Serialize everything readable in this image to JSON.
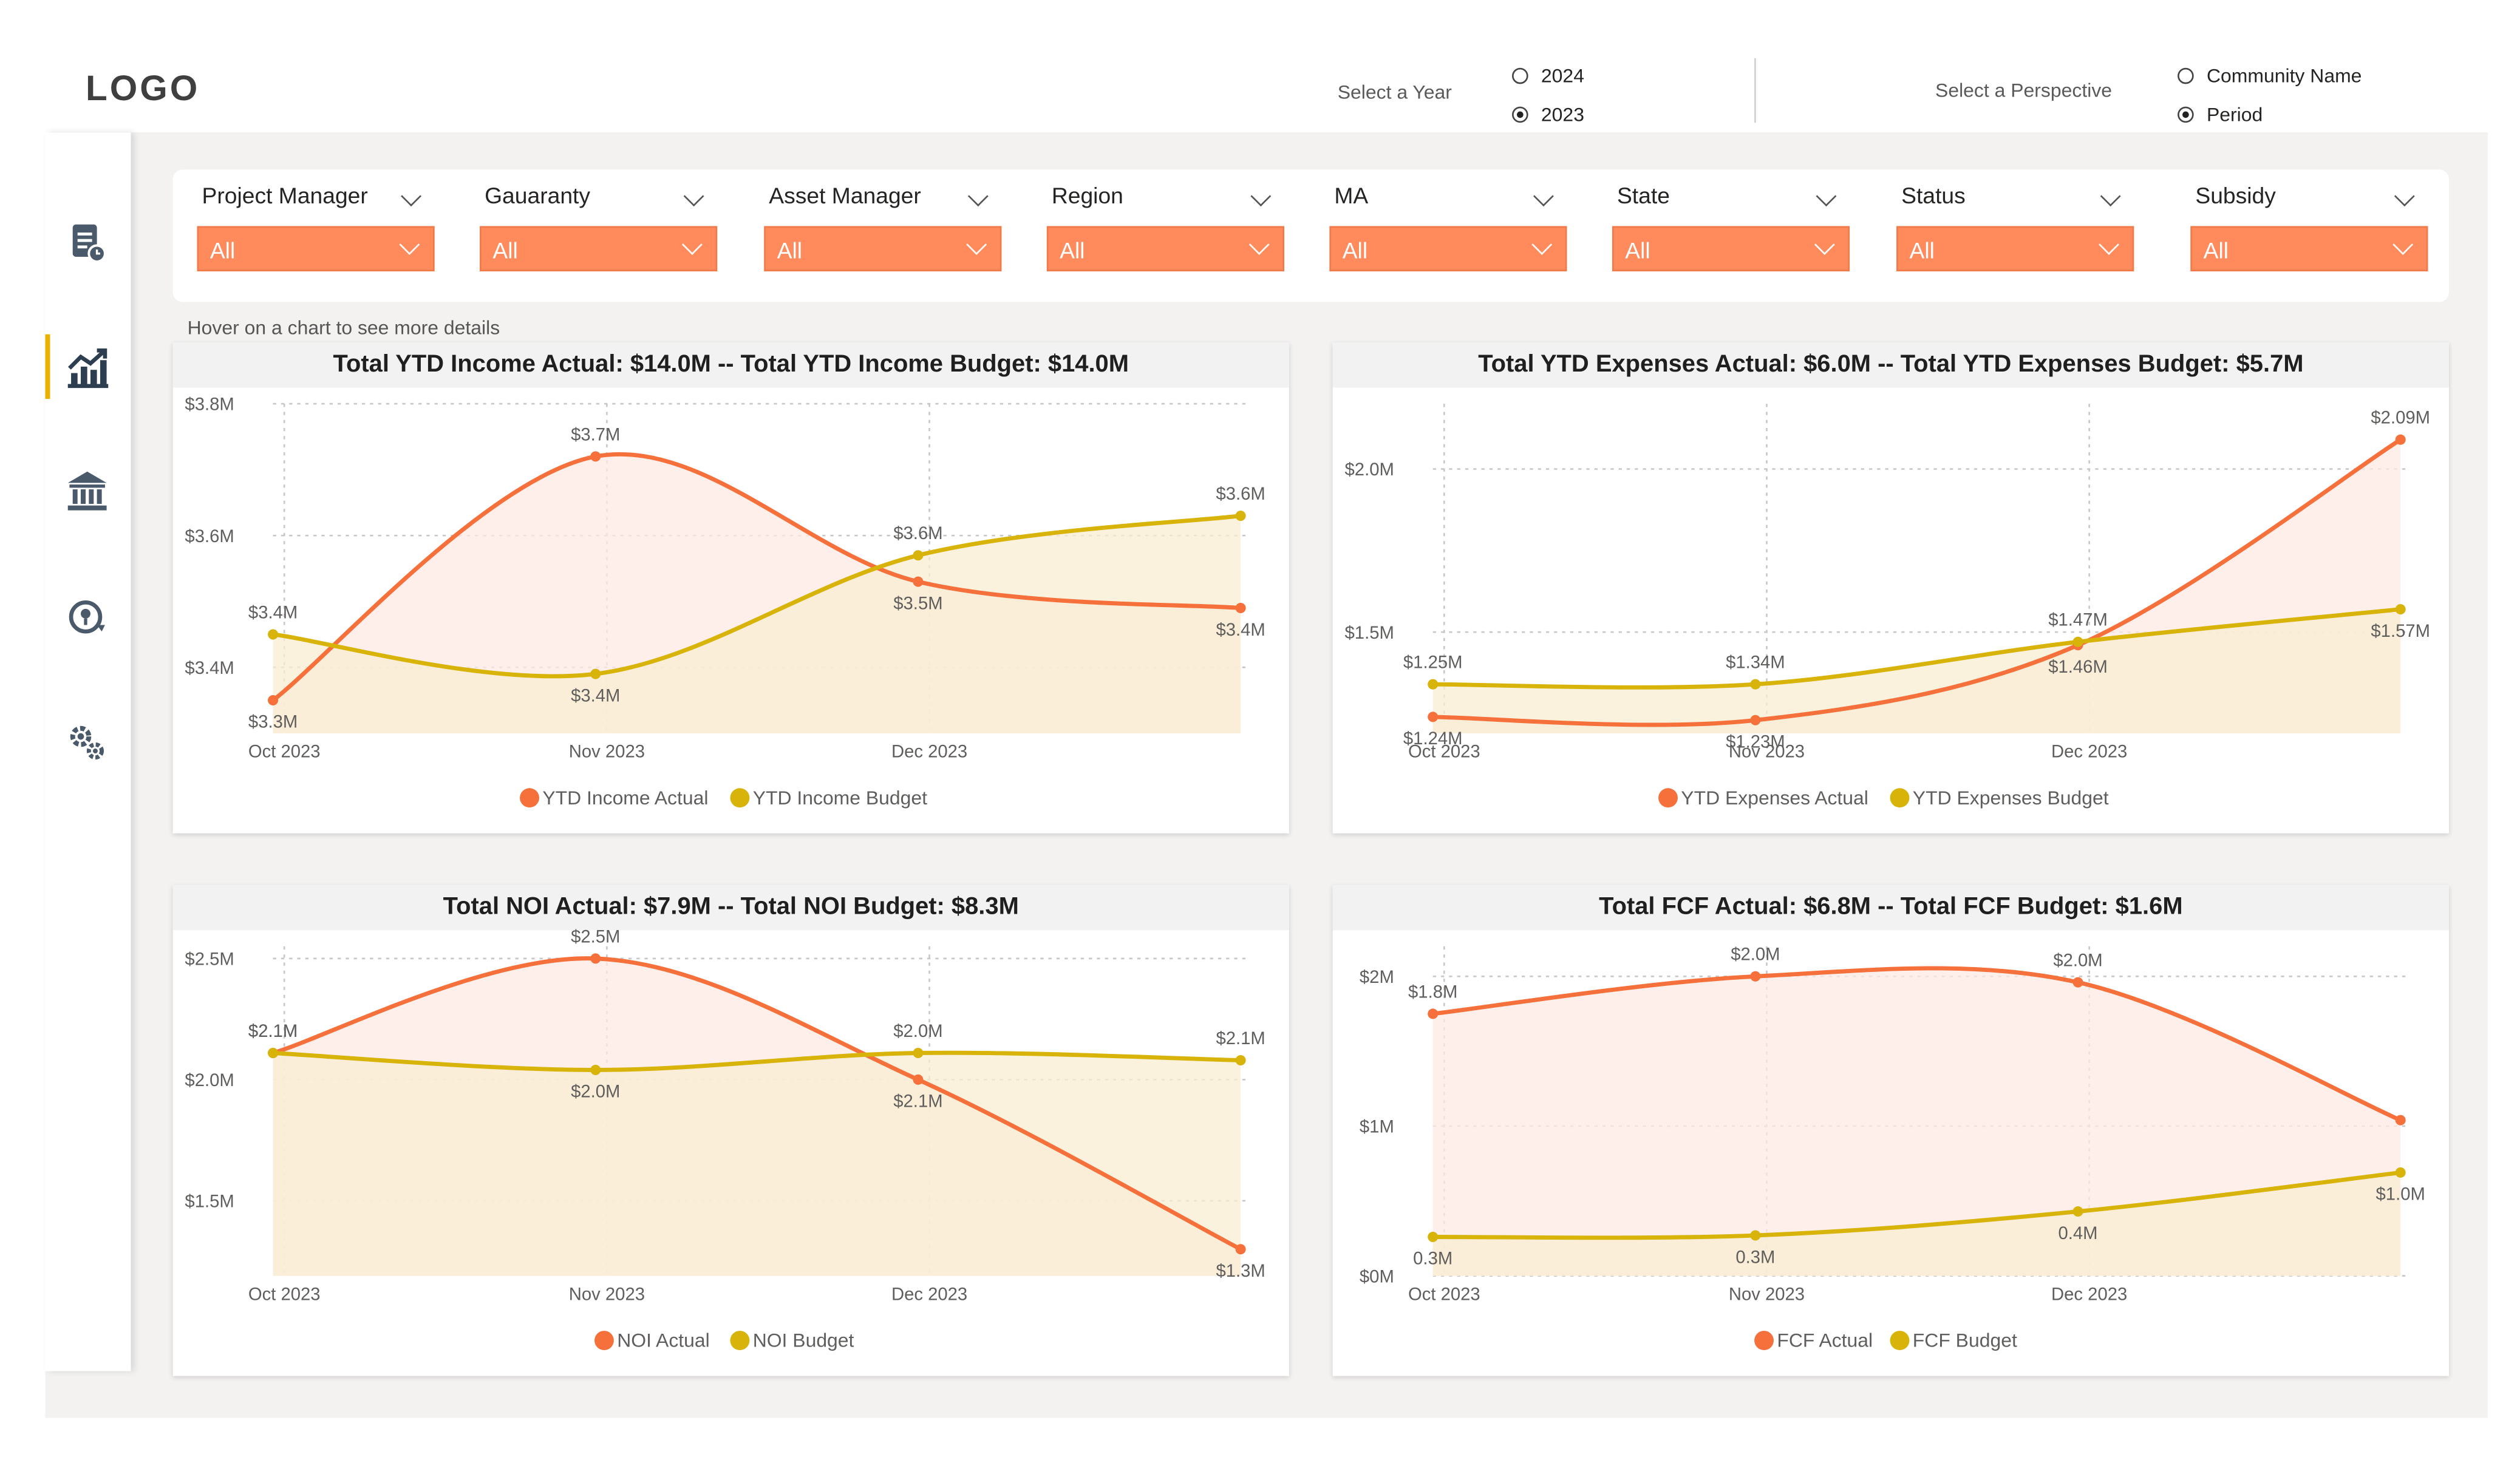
{
  "header": {
    "logo": "LOGO",
    "year_label": "Select a Year",
    "year_options": [
      "2024",
      "2023"
    ],
    "year_selected": "2023",
    "perspective_label": "Select a Perspective",
    "perspective_options": [
      "Community Name",
      "Period"
    ],
    "perspective_selected": "Period"
  },
  "sidebar": {
    "items": [
      {
        "icon": "report-icon"
      },
      {
        "icon": "trending-chart-icon",
        "active": true
      },
      {
        "icon": "bank-icon"
      },
      {
        "icon": "location-refresh-icon"
      },
      {
        "icon": "settings-gears-icon"
      }
    ],
    "active_color": "#e8b100"
  },
  "filters": [
    {
      "label": "Project Manager",
      "value": "All"
    },
    {
      "label": "Gauaranty",
      "value": "All"
    },
    {
      "label": "Asset Manager",
      "value": "All"
    },
    {
      "label": "Region",
      "value": "All"
    },
    {
      "label": "MA",
      "value": "All"
    },
    {
      "label": "State",
      "value": "All"
    },
    {
      "label": "Status",
      "value": "All"
    },
    {
      "label": "Subsidy",
      "value": "All"
    }
  ],
  "hover_hint": "Hover on a chart to see more details",
  "colors": {
    "actual": "#f5703a",
    "budget": "#d8b40a",
    "filter_bg": "#ff8a5b",
    "actual_fill": "#fde9e4",
    "budget_fill": "#f8eed1"
  },
  "chart_data": [
    {
      "type": "area",
      "title": "Total YTD Income Actual: $14.0M -- Total YTD Income Budget: $14.0M",
      "x": [
        "Oct 2023",
        "Nov 2023",
        "Dec 2023",
        ""
      ],
      "y_ticks": [
        "$3.4M",
        "$3.6M",
        "$3.8M"
      ],
      "ylim": [
        3.3,
        3.8
      ],
      "grid": true,
      "legend_position": "bottom",
      "series": [
        {
          "name": "YTD Income Actual",
          "values": [
            3.35,
            3.72,
            3.53,
            3.49
          ],
          "labels": [
            "$3.3M",
            "$3.7M",
            "$3.5M",
            "$3.4M"
          ]
        },
        {
          "name": "YTD Income Budget",
          "values": [
            3.45,
            3.39,
            3.57,
            3.63
          ],
          "labels": [
            "$3.4M",
            "$3.4M",
            "$3.6M",
            "$3.6M"
          ]
        }
      ]
    },
    {
      "type": "area",
      "title": "Total YTD Expenses Actual: $6.0M -- Total YTD Expenses Budget: $5.7M",
      "x": [
        "Oct 2023",
        "Nov 2023",
        "Dec 2023",
        ""
      ],
      "y_ticks": [
        "$1.5M",
        "$2.0M"
      ],
      "ylim": [
        1.19,
        2.2
      ],
      "grid": true,
      "legend_position": "bottom",
      "series": [
        {
          "name": "YTD Expenses Actual",
          "values": [
            1.24,
            1.23,
            1.46,
            2.09
          ],
          "labels": [
            "$1.24M",
            "$1.23M",
            "$1.46M",
            "$2.09M"
          ]
        },
        {
          "name": "YTD Expenses Budget",
          "values": [
            1.34,
            1.34,
            1.47,
            1.57
          ],
          "labels": [
            "$1.25M",
            "$1.34M",
            "$1.47M",
            "$1.57M"
          ]
        }
      ]
    },
    {
      "type": "area",
      "title": "Total NOI Actual: $7.9M -- Total NOI Budget: $8.3M",
      "x": [
        "Oct 2023",
        "Nov 2023",
        "Dec 2023",
        ""
      ],
      "y_ticks": [
        "$1.5M",
        "$2.0M",
        "$2.5M"
      ],
      "ylim": [
        1.19,
        2.55
      ],
      "grid": true,
      "legend_position": "bottom",
      "series": [
        {
          "name": "NOI Actual",
          "values": [
            2.11,
            2.5,
            2.0,
            1.3
          ],
          "labels": [
            "$2.1M",
            "$2.5M",
            "$2.1M",
            "$1.3M"
          ]
        },
        {
          "name": "NOI Budget",
          "values": [
            2.11,
            2.04,
            2.11,
            2.08
          ],
          "labels": [
            "$2.1M",
            "$2.0M",
            "$2.0M",
            "$2.1M"
          ]
        }
      ]
    },
    {
      "type": "area",
      "title": "Total FCF Actual: $6.8M -- Total FCF Budget: $1.6M",
      "x": [
        "Oct 2023",
        "Nov 2023",
        "Dec 2023",
        ""
      ],
      "y_ticks": [
        "$0M",
        "$1M",
        "$2M"
      ],
      "ylim": [
        0,
        2.2
      ],
      "grid": true,
      "legend_position": "bottom",
      "series": [
        {
          "name": "FCF Actual",
          "values": [
            1.75,
            2.0,
            1.96,
            1.04
          ],
          "labels": [
            "$1.8M",
            "$2.0M",
            "$2.0M",
            ""
          ]
        },
        {
          "name": "FCF Budget",
          "values": [
            0.26,
            0.27,
            0.43,
            0.69
          ],
          "labels": [
            "0.3M",
            "0.3M",
            "0.4M",
            "$1.0M"
          ]
        }
      ]
    }
  ]
}
